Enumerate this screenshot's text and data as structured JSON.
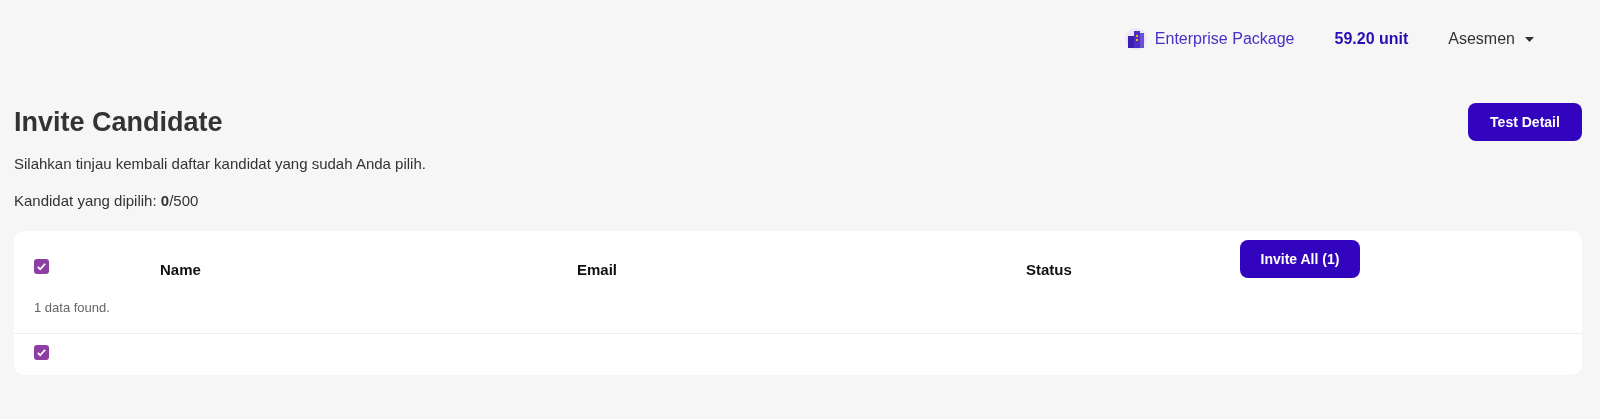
{
  "top_bar": {
    "package": "Enterprise Package",
    "balance": "59.20 unit",
    "menu": "Asesmen"
  },
  "page": {
    "title": "Invite Candidate",
    "test_detail_button": "Test Detail",
    "description": "Silahkan tinjau kembali daftar kandidat yang sudah Anda pilih.",
    "selected_count": "Kandidat yang dipilih: **0**/500"
  },
  "table": {
    "select_all": {
      "checked": true
    },
    "columns": [
      "Name",
      "Email",
      "Status"
    ],
    "invite_all_button": "Invite All (1)",
    "result_count": "1 data found.",
    "rows": [
      {
        "selected": true
      }
    ]
  }
}
